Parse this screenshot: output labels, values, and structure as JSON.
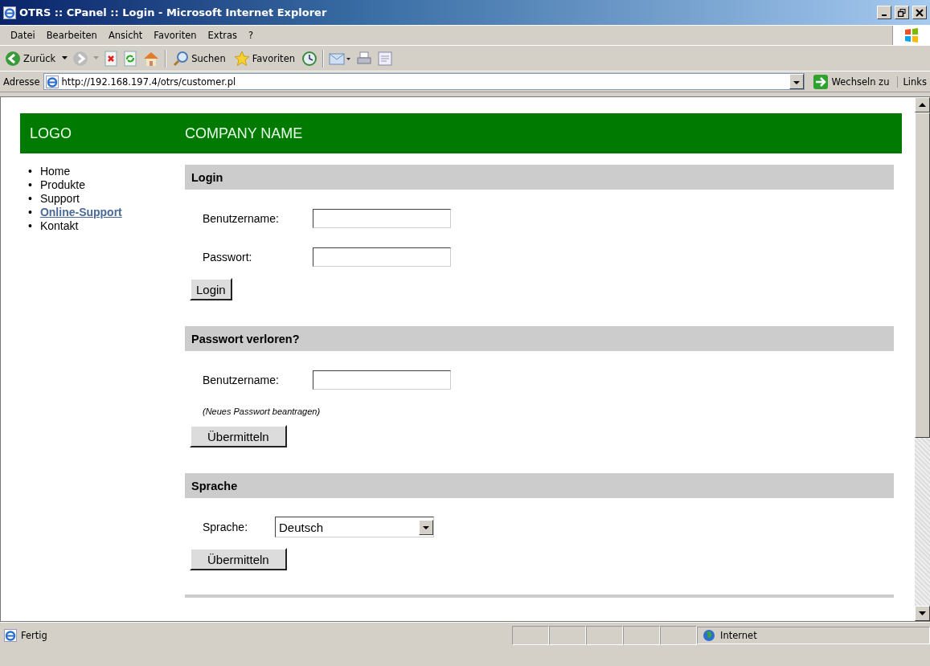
{
  "window": {
    "title": "OTRS :: CPanel :: Login - Microsoft Internet Explorer"
  },
  "menu": [
    "Datei",
    "Bearbeiten",
    "Ansicht",
    "Favoriten",
    "Extras",
    "?"
  ],
  "toolbar": [
    {
      "kind": "back",
      "label": "Zurück"
    },
    {
      "kind": "forward"
    },
    {
      "kind": "stop"
    },
    {
      "kind": "refresh"
    },
    {
      "kind": "home"
    },
    {
      "kind": "search",
      "label": "Suchen"
    },
    {
      "kind": "favorites",
      "label": "Favoriten"
    },
    {
      "kind": "history"
    },
    {
      "kind": "mail"
    },
    {
      "kind": "print"
    },
    {
      "kind": "edit"
    }
  ],
  "address": {
    "label": "Adresse",
    "value": "http://192.168.197.4/otrs/customer.pl",
    "go": "Wechseln zu",
    "links": "Links"
  },
  "page": {
    "logo": "LOGO",
    "company": "COMPANY NAME",
    "nav": [
      {
        "bullet": "•",
        "label": "Home",
        "selected": false
      },
      {
        "bullet": "•",
        "label": "Produkte",
        "selected": false
      },
      {
        "bullet": "•",
        "label": "Support",
        "selected": false
      },
      {
        "bullet": "•",
        "label": "Online-Support",
        "selected": true
      },
      {
        "bullet": "•",
        "label": "Kontakt",
        "selected": false
      }
    ],
    "sections": [
      {
        "title": "Login",
        "items": [
          {
            "kind": "input",
            "label": "Benutzername:"
          },
          {
            "kind": "input",
            "label": "Passwort:"
          },
          {
            "kind": "button",
            "label": "Login"
          }
        ]
      },
      {
        "title": "Passwort verloren?",
        "items": [
          {
            "kind": "input",
            "label": "Benutzername:"
          },
          {
            "kind": "note",
            "label": "(Neues Passwort beantragen)"
          },
          {
            "kind": "button",
            "label": "Übermitteln"
          }
        ]
      },
      {
        "title": "Sprache",
        "items": [
          {
            "kind": "select",
            "label": "Sprache:",
            "value": "Deutsch"
          },
          {
            "kind": "button",
            "label": "Übermitteln"
          }
        ]
      }
    ]
  },
  "status_bar": {
    "text": "Fertig",
    "zone": "Internet"
  }
}
